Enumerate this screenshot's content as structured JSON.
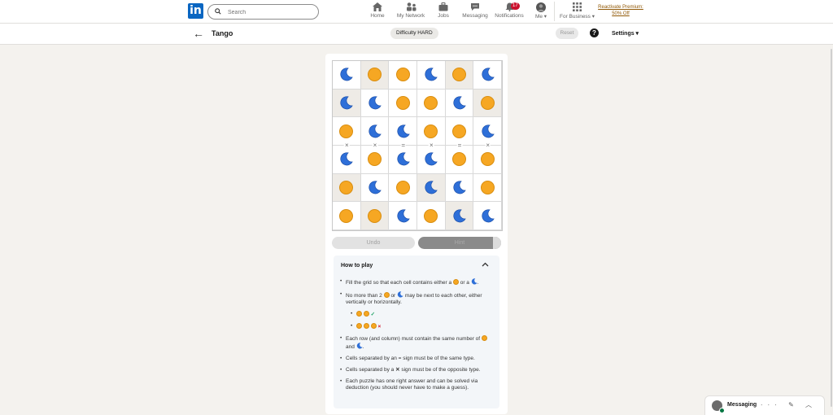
{
  "nav": {
    "logo": "in",
    "search_placeholder": "Search",
    "items": [
      {
        "label": "Home",
        "icon": "home-icon"
      },
      {
        "label": "My Network",
        "icon": "network-icon"
      },
      {
        "label": "Jobs",
        "icon": "briefcase-icon"
      },
      {
        "label": "Messaging",
        "icon": "chat-icon"
      },
      {
        "label": "Notifications",
        "icon": "bell-icon",
        "badge": "17"
      },
      {
        "label": "Me ▾",
        "icon": "avatar"
      }
    ],
    "business": "For Business ▾",
    "premium": "Reactivate Premium: 50% Off"
  },
  "game": {
    "title": "Tango",
    "difficulty": "Difficulty HARD",
    "reset": "Reset",
    "help": "?",
    "settings": "Settings ▾"
  },
  "board": {
    "size": 6,
    "cells": [
      [
        "moon",
        "sun",
        "sun",
        "moon",
        "sun",
        "moon"
      ],
      [
        "moon",
        "moon",
        "sun",
        "sun",
        "moon",
        "sun"
      ],
      [
        "sun",
        "moon",
        "moon",
        "sun",
        "sun",
        "moon"
      ],
      [
        "moon",
        "sun",
        "moon",
        "moon",
        "sun",
        "sun"
      ],
      [
        "sun",
        "moon",
        "sun",
        "moon",
        "moon",
        "sun"
      ],
      [
        "sun",
        "sun",
        "moon",
        "sun",
        "moon",
        "moon"
      ]
    ],
    "locked": [
      [
        0,
        1
      ],
      [
        0,
        4
      ],
      [
        1,
        0
      ],
      [
        1,
        5
      ],
      [
        4,
        0
      ],
      [
        4,
        3
      ],
      [
        5,
        1
      ],
      [
        5,
        4
      ]
    ],
    "constraints_between_row3_row4": [
      "×",
      "×",
      "=",
      "×",
      "=",
      "×"
    ]
  },
  "buttons": {
    "undo": "Undo",
    "hint": "Hint"
  },
  "howto": {
    "title": "How to play",
    "r1a": "Fill the grid so that each cell contains either a",
    "r1b": "or a",
    "r1c": ".",
    "r2a": "No more than 2",
    "r2b": "or",
    "r2c": "may be next to each other, either vertically or horizontally.",
    "ok_mark": "✓",
    "bad_mark": "×",
    "r3a": "Each row (and column) must contain the same number of",
    "r3b": "and",
    "r3c": ".",
    "r4": "Cells separated by an = sign must be of the same type.",
    "r5a": "Cells separated by a",
    "r5x": "✕",
    "r5b": "sign must be of the opposite type.",
    "r6": "Each puzzle has one right answer and can be solved via deduction (you should never have to make a guess)."
  },
  "messaging": {
    "label": "Messaging",
    "actions": "··· ✎ ︿"
  },
  "colors": {
    "sun": "#f6a723",
    "moon": "#2e6fd8",
    "locked_cell": "#eeebe6",
    "brand": "#0a66c2"
  }
}
